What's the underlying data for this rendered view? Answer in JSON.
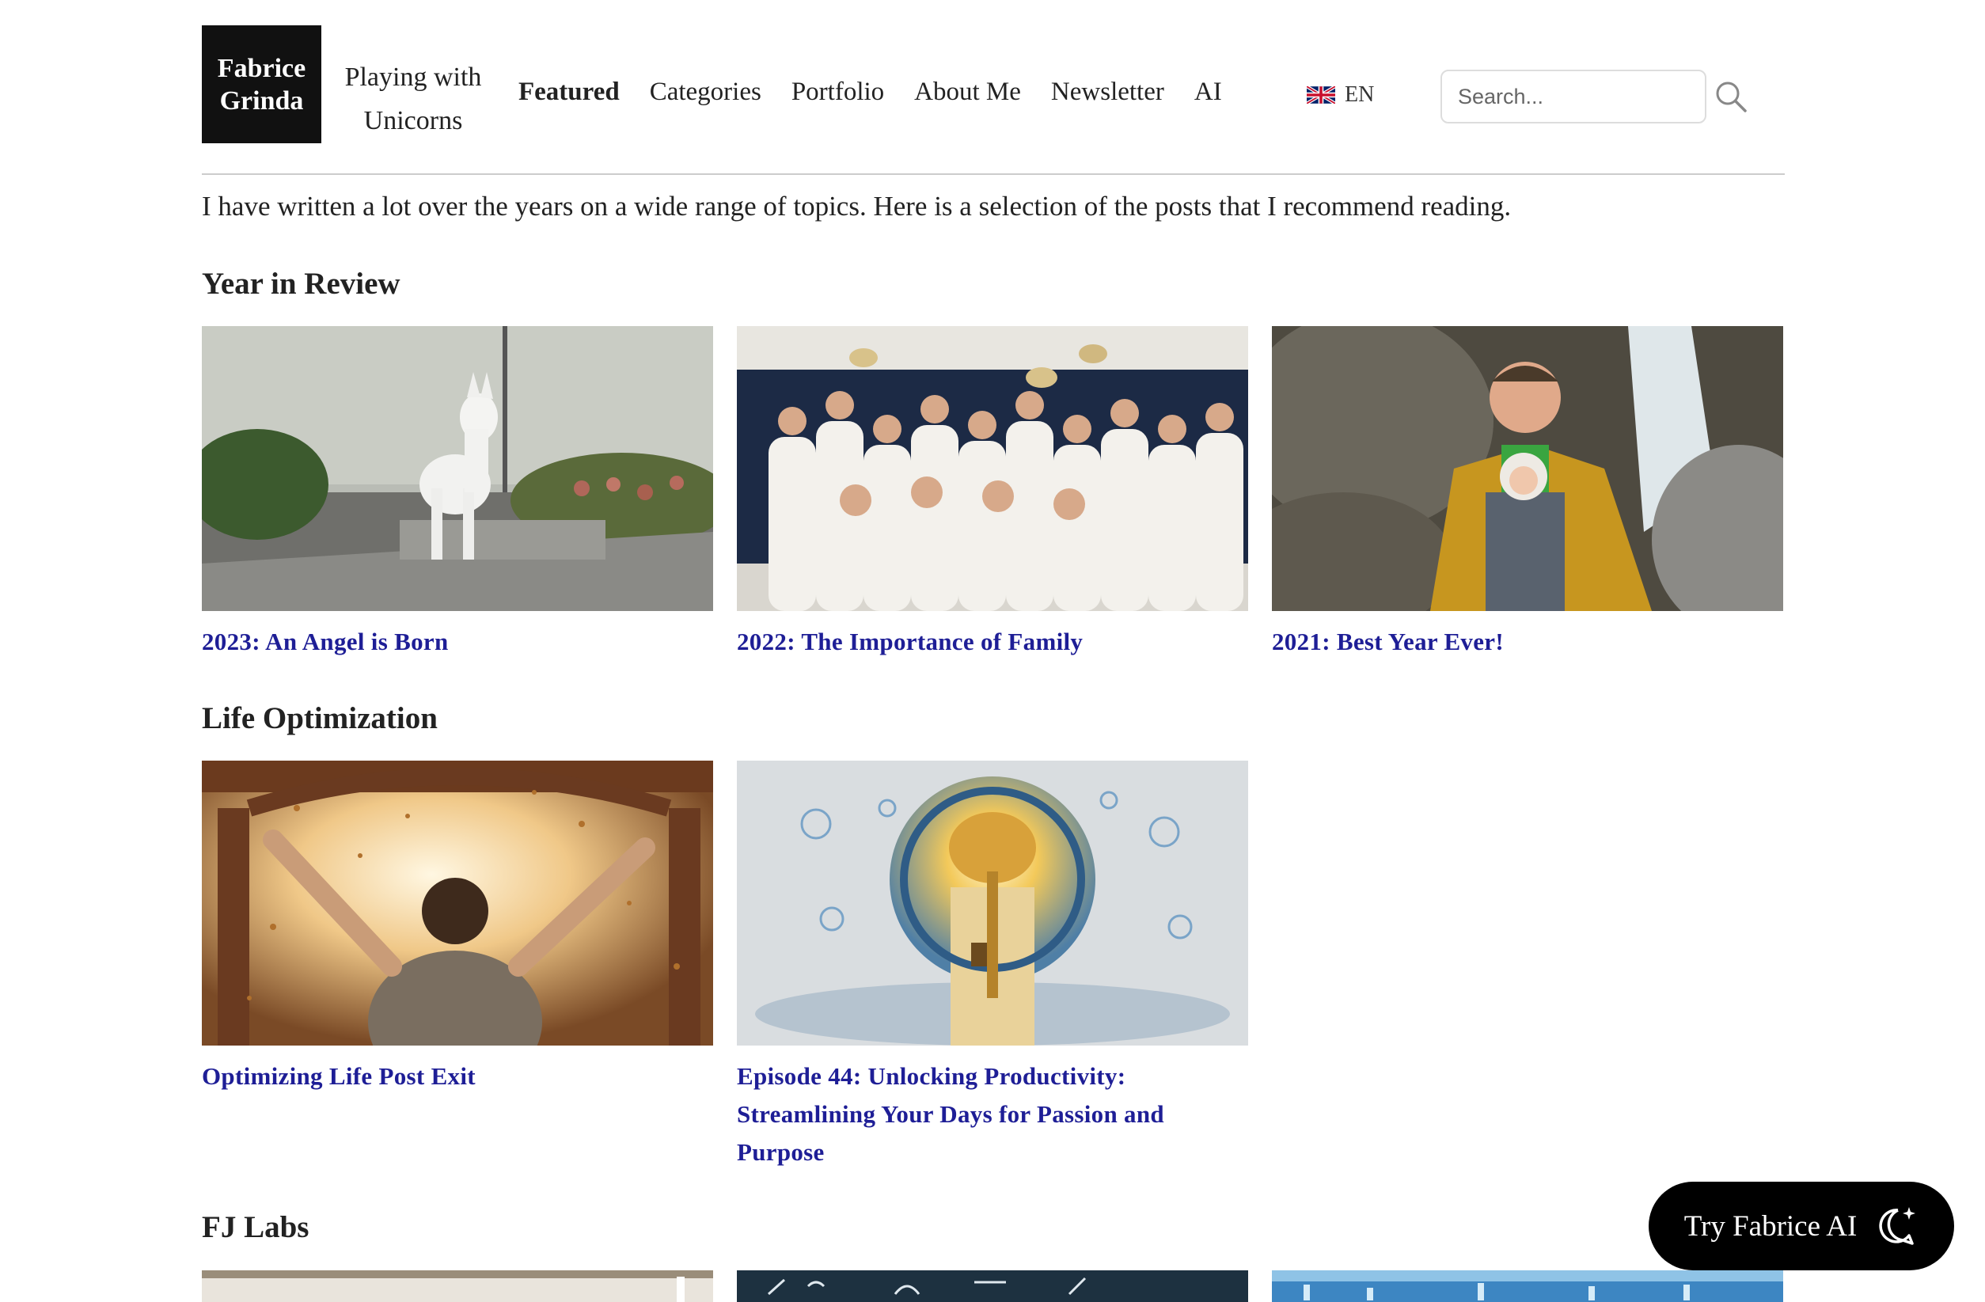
{
  "header": {
    "logo_line1": "Fabrice",
    "logo_line2": "Grinda",
    "tagline_line1": "Playing with",
    "tagline_line2": "Unicorns",
    "nav": [
      {
        "label": "Featured",
        "active": true
      },
      {
        "label": "Categories"
      },
      {
        "label": "Portfolio"
      },
      {
        "label": "About Me"
      },
      {
        "label": "Newsletter"
      },
      {
        "label": "AI"
      }
    ],
    "language": {
      "label": "EN",
      "flag_icon": "uk-flag-icon"
    },
    "search": {
      "placeholder": "Search...",
      "value": "",
      "icon": "search-icon"
    }
  },
  "intro": "I have written a lot over the years on a wide range of topics. Here is a selection of the posts that I recommend reading.",
  "sections": [
    {
      "title": "Year in Review",
      "posts": [
        {
          "title": "2023: An Angel is Born"
        },
        {
          "title": "2022: The Importance of Family"
        },
        {
          "title": "2021: Best Year Ever!"
        }
      ]
    },
    {
      "title": "Life Optimization",
      "posts": [
        {
          "title": "Optimizing Life Post Exit"
        },
        {
          "title_line1": "Episode 44: Unlocking Productivity:",
          "title_line2": "Streamlining Your Days for Passion and",
          "title_line3": "Purpose"
        }
      ]
    },
    {
      "title": "FJ Labs",
      "posts": []
    }
  ],
  "ai_button": {
    "label": "Try Fabrice AI",
    "icon": "chat-sparkle-icon"
  },
  "colors": {
    "link": "#1e1e96",
    "logo_bg": "#111111",
    "ai_bg": "#000000",
    "divider": "#cccccc"
  }
}
